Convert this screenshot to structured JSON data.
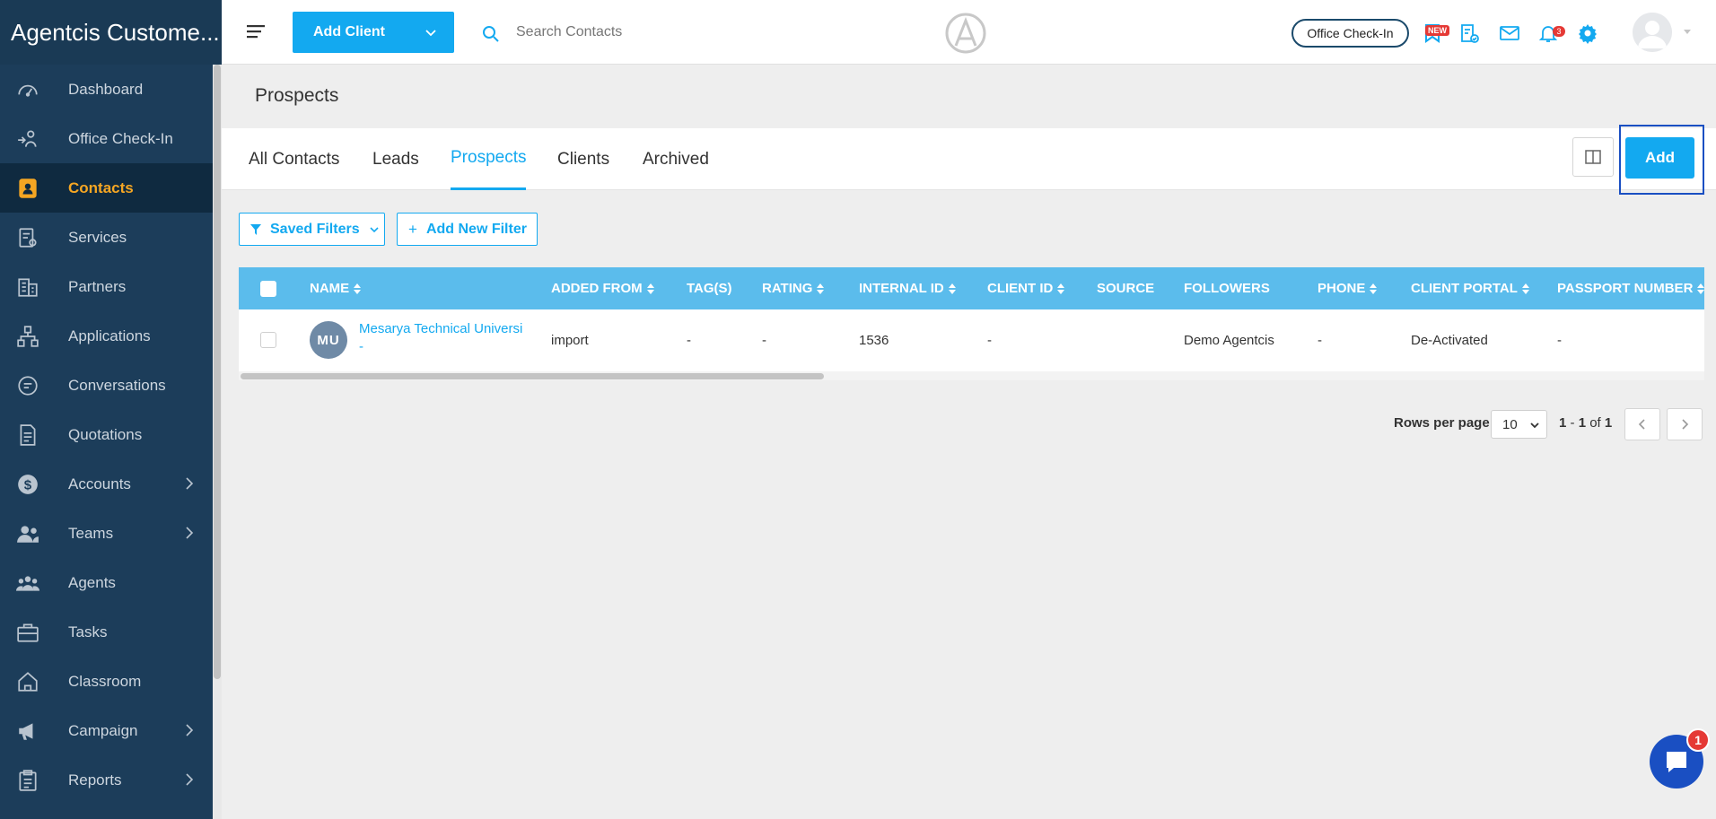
{
  "sidebar": {
    "brand": "Agentcis Custome...",
    "items": [
      {
        "label": "Dashboard",
        "icon": "dashboard-icon"
      },
      {
        "label": "Office Check-In",
        "icon": "office-checkin-icon"
      },
      {
        "label": "Contacts",
        "icon": "contacts-icon",
        "active": true
      },
      {
        "label": "Services",
        "icon": "services-icon"
      },
      {
        "label": "Partners",
        "icon": "partners-icon"
      },
      {
        "label": "Applications",
        "icon": "applications-icon"
      },
      {
        "label": "Conversations",
        "icon": "conversations-icon"
      },
      {
        "label": "Quotations",
        "icon": "quotations-icon"
      },
      {
        "label": "Accounts",
        "icon": "accounts-icon",
        "expandable": true
      },
      {
        "label": "Teams",
        "icon": "teams-icon",
        "expandable": true
      },
      {
        "label": "Agents",
        "icon": "agents-icon"
      },
      {
        "label": "Tasks",
        "icon": "tasks-icon"
      },
      {
        "label": "Classroom",
        "icon": "classroom-icon"
      },
      {
        "label": "Campaign",
        "icon": "campaign-icon",
        "expandable": true
      },
      {
        "label": "Reports",
        "icon": "reports-icon",
        "expandable": true
      }
    ]
  },
  "header": {
    "add_client_label": "Add Client",
    "search_placeholder": "Search Contacts",
    "office_checkin_label": "Office Check-In",
    "new_badge": "NEW",
    "notification_count": "3"
  },
  "page": {
    "title": "Prospects",
    "tabs": [
      "All Contacts",
      "Leads",
      "Prospects",
      "Clients",
      "Archived"
    ],
    "active_tab": "Prospects",
    "add_label": "Add"
  },
  "filters": {
    "saved_filters_label": "Saved Filters",
    "add_new_filter_label": "Add New Filter"
  },
  "table": {
    "columns": [
      "NAME",
      "ADDED FROM",
      "TAG(S)",
      "RATING",
      "INTERNAL ID",
      "CLIENT ID",
      "SOURCE",
      "FOLLOWERS",
      "PHONE",
      "CLIENT PORTAL",
      "PASSPORT NUMBER"
    ],
    "rows": [
      {
        "initials": "MU",
        "name": "Mesarya Technical Universi",
        "name_suffix": "-",
        "added_from": "import",
        "tags": "-",
        "rating": "-",
        "internal_id": "1536",
        "client_id": "-",
        "source": "",
        "followers": "Demo Agentcis",
        "phone": "-",
        "client_portal": "De-Activated",
        "passport_number": "-"
      }
    ]
  },
  "pagination": {
    "rows_per_page_label": "Rows per page",
    "rows_per_page": "10",
    "range_start": "1",
    "range_sep": " - ",
    "range_end": "1",
    "of_label": " of ",
    "total": "1"
  },
  "chat": {
    "badge": "1"
  },
  "colors": {
    "sidebar": "#1c3d5a",
    "accent": "#13a9f0",
    "active_nav": "#f5a623",
    "table_header": "#5bbcec"
  }
}
